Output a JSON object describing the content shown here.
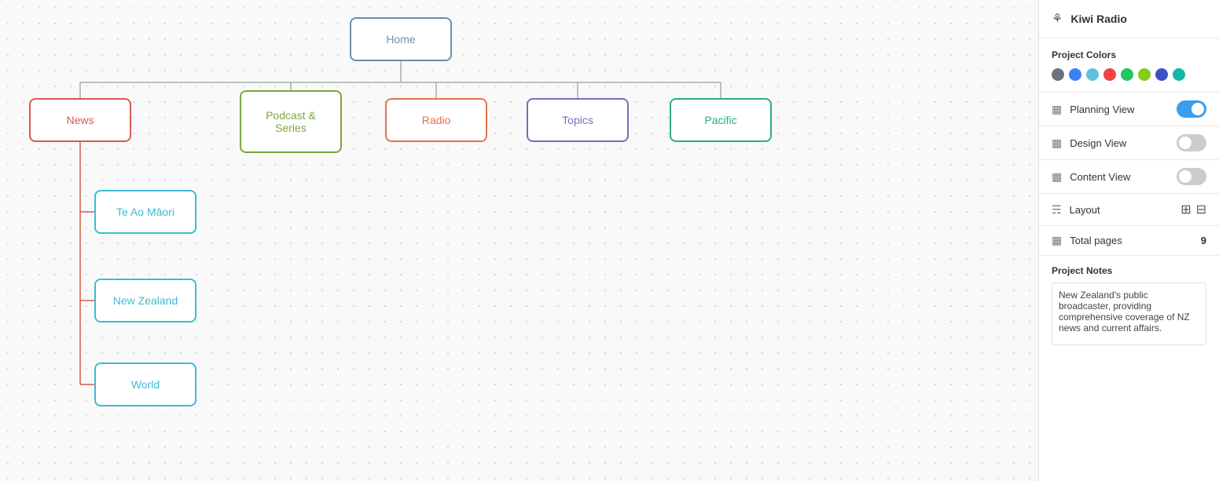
{
  "sidebar": {
    "project_name": "Kiwi Radio",
    "project_colors_label": "Project Colors",
    "colors": [
      {
        "name": "gray",
        "hex": "#6b7280"
      },
      {
        "name": "blue",
        "hex": "#3b82f6"
      },
      {
        "name": "light-blue",
        "hex": "#60c0e0"
      },
      {
        "name": "red",
        "hex": "#ef4444"
      },
      {
        "name": "green",
        "hex": "#22c55e"
      },
      {
        "name": "olive",
        "hex": "#84cc16"
      },
      {
        "name": "dark-blue",
        "hex": "#3b4fc8"
      },
      {
        "name": "teal",
        "hex": "#14b8a6"
      }
    ],
    "planning_view_label": "Planning View",
    "planning_view_on": true,
    "design_view_label": "Design View",
    "design_view_on": false,
    "content_view_label": "Content View",
    "content_view_on": false,
    "layout_label": "Layout",
    "total_pages_label": "Total pages",
    "total_pages_count": "9",
    "notes_label": "Project Notes",
    "notes_text": "New Zealand's public broadcaster, providing comprehensive coverage of NZ news and current affairs."
  },
  "diagram": {
    "nodes": {
      "home": {
        "label": "Home"
      },
      "news": {
        "label": "News"
      },
      "podcast": {
        "label": "Podcast &\nSeries"
      },
      "radio": {
        "label": "Radio"
      },
      "topics": {
        "label": "Topics"
      },
      "pacific": {
        "label": "Pacific"
      },
      "te_ao": {
        "label": "Te Ao Māori"
      },
      "new_zealand": {
        "label": "New Zealand"
      },
      "world": {
        "label": "World"
      }
    }
  }
}
